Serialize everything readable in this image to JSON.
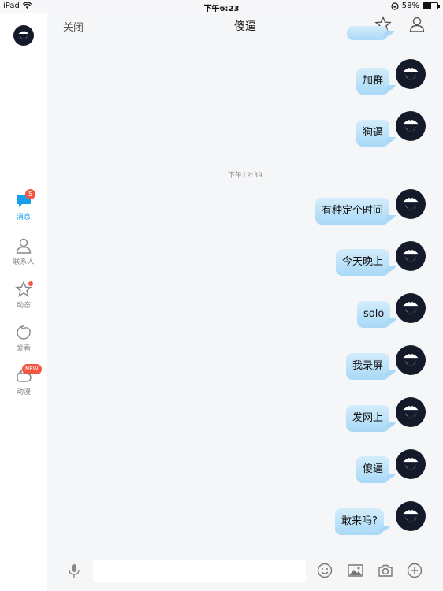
{
  "status_bar": {
    "device": "iPad",
    "time": "下午6:23",
    "battery": "58%",
    "battery_level": 0.58
  },
  "sidebar": {
    "items": [
      {
        "label": "消息",
        "badge": "5"
      },
      {
        "label": "联系人"
      },
      {
        "label": "动态"
      },
      {
        "label": "爱看"
      },
      {
        "label": "动漫",
        "badge": "NEW"
      }
    ]
  },
  "header": {
    "close_label": "关闭",
    "title": "傻逼"
  },
  "chat": {
    "messages": [
      {
        "text": "加群"
      },
      {
        "text": "狗逼"
      },
      {
        "text": "有种定个时间"
      },
      {
        "text": "今天晚上"
      },
      {
        "text": "solo"
      },
      {
        "text": "我录屏"
      },
      {
        "text": "发网上"
      },
      {
        "text": "傻逼"
      },
      {
        "text": "敢来吗?"
      }
    ],
    "timestamp": "下午12:39"
  },
  "input": {
    "placeholder": ""
  },
  "colors": {
    "accent": "#16a0ea",
    "bubble": "#b7e0f9",
    "badge": "#f25643"
  },
  "icons": [
    "microphone-icon",
    "emoji-icon",
    "image-icon",
    "camera-icon",
    "plus-icon",
    "star-icon",
    "profile-icon"
  ]
}
